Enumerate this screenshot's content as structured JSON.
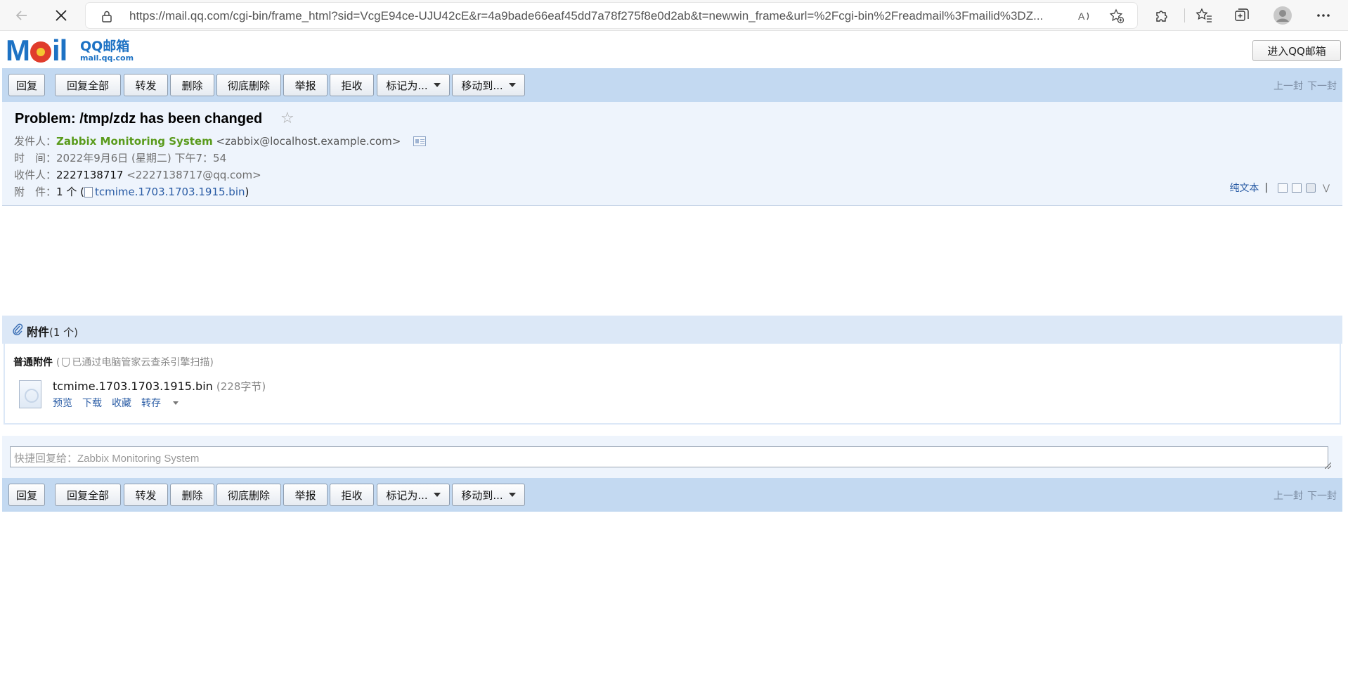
{
  "browser": {
    "url": "https://mail.qq.com/cgi-bin/frame_html?sid=VcgE94ce-UJU42cE&r=4a9bade66eaf45dd7a78f275f8e0d2ab&t=newwin_frame&url=%2Fcgi-bin%2Freadmail%3Fmailid%3DZ..."
  },
  "header": {
    "logo_big": "MOil",
    "logo_text": "QQ邮箱",
    "logo_domain": "mail.qq.com",
    "enter_button": "进入QQ邮箱"
  },
  "toolbar": {
    "reply": "回复",
    "reply_all": "回复全部",
    "forward": "转发",
    "delete": "删除",
    "delete_permanently": "彻底删除",
    "report": "举报",
    "reject": "拒收",
    "mark_as": "标记为...",
    "move_to": "移动到...",
    "prev": "上一封",
    "next": "下一封"
  },
  "mail": {
    "subject": "Problem: /tmp/zdz has been changed",
    "sender_label": "发件人：",
    "sender_name": "Zabbix Monitoring System",
    "sender_email": "<zabbix@localhost.example.com>",
    "time_label": "时　间：",
    "time_value": "2022年9月6日 (星期二) 下午7：54",
    "recipient_label": "收件人：",
    "recipient_name": "2227138717",
    "recipient_email": "<2227138717@qq.com>",
    "attach_label": "附　件：",
    "attach_count": "1 个 (",
    "attach_name": "tcmime.1703.1703.1915.bin",
    "attach_close": ")",
    "plain_text": "纯文本",
    "separator": "|"
  },
  "attachments": {
    "title": "附件",
    "count": "(1 个)",
    "normal_label": "普通附件",
    "scan_open": "(",
    "scan_note": "已通过电脑管家云查杀引擎扫描)",
    "file_name": "tcmime.1703.1703.1915.bin",
    "file_size": "(228字节)",
    "preview": "预览",
    "download": "下载",
    "collect": "收藏",
    "save_to": "转存"
  },
  "quick_reply": {
    "placeholder": "快捷回复给：Zabbix Monitoring System"
  },
  "icons": {
    "back": "back-arrow-icon",
    "stop": "close-icon",
    "lock": "lock-icon",
    "read_aloud": "read-aloud-icon",
    "favorite_add": "add-favorite-icon",
    "extensions": "puzzle-icon",
    "favorites": "favorites-icon",
    "collections": "collections-icon",
    "profile": "profile-icon",
    "more": "more-icon",
    "star": "star-icon",
    "attachment": "paperclip-icon"
  }
}
